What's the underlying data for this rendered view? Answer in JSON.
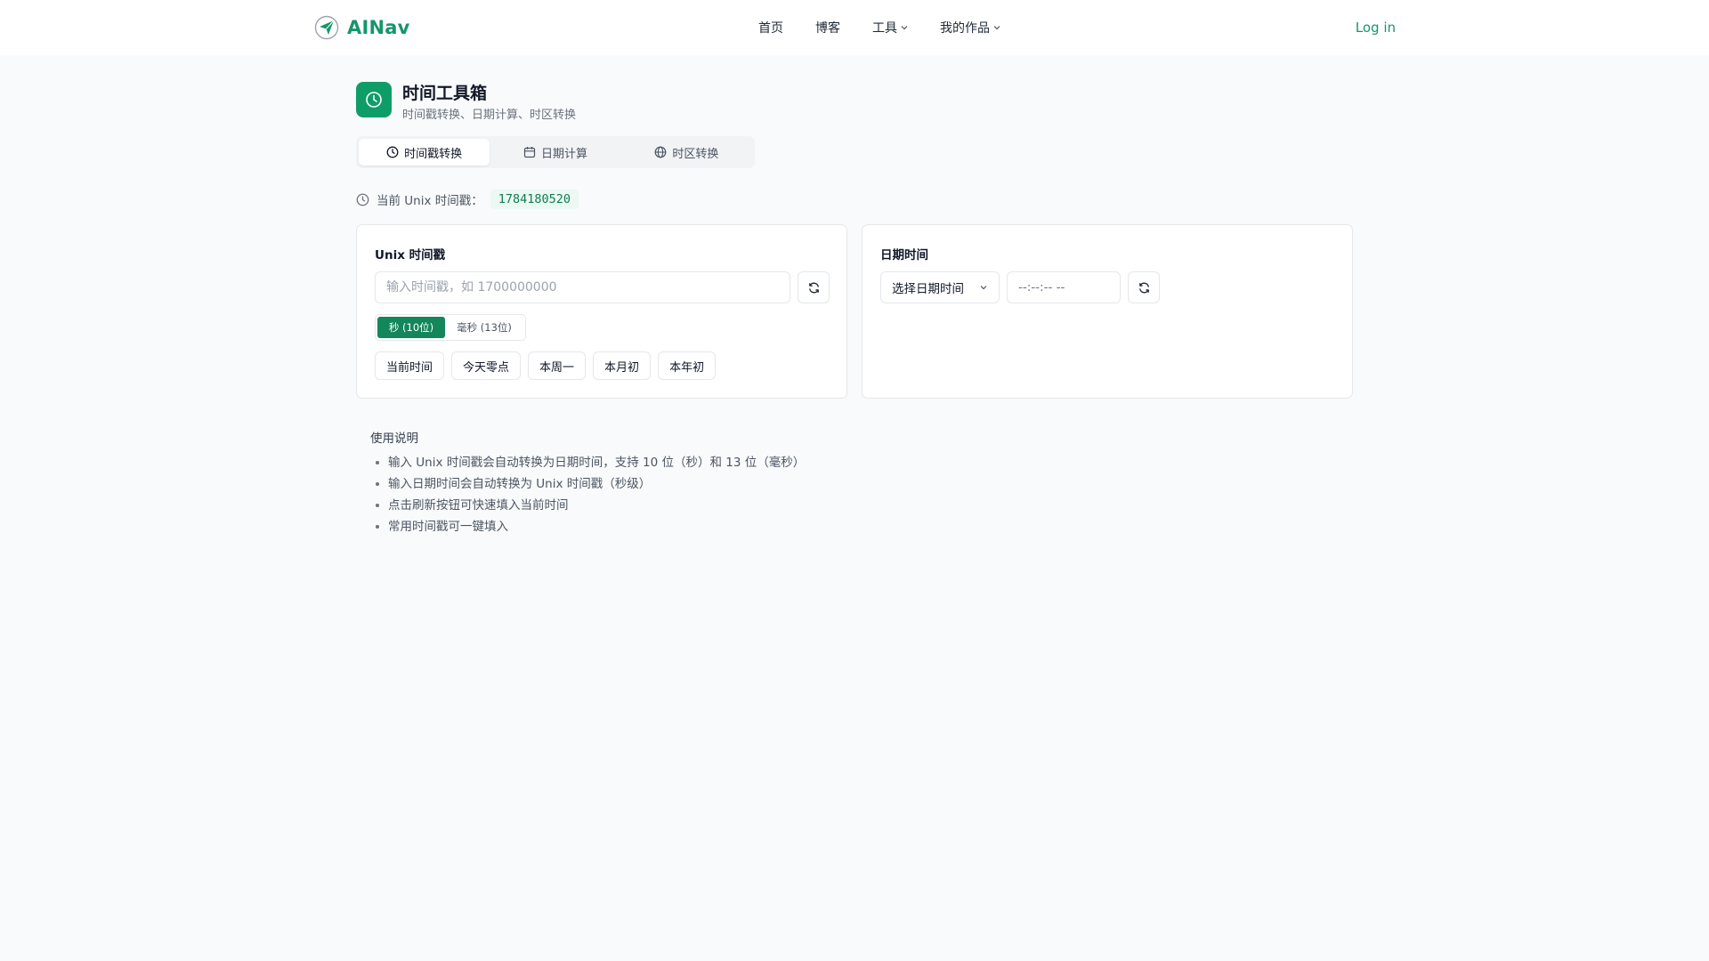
{
  "header": {
    "brand": "AINav",
    "nav": [
      "首页",
      "博客",
      "工具",
      "我的作品"
    ],
    "login": "Log in"
  },
  "page": {
    "title": "时间工具箱",
    "subtitle": "时间戳转换、日期计算、时区转换"
  },
  "tabs": [
    "时间戳转换",
    "日期计算",
    "时区转换"
  ],
  "current": {
    "label": "当前 Unix 时间戳：",
    "value": "1784180520"
  },
  "unix_card": {
    "title": "Unix 时间戳",
    "placeholder": "输入时间戳，如 1700000000",
    "units": [
      "秒 (10位)",
      "毫秒 (13位)"
    ],
    "quick": [
      "当前时间",
      "今天零点",
      "本周一",
      "本月初",
      "本年初"
    ]
  },
  "date_card": {
    "title": "日期时间",
    "date_select": "选择日期时间",
    "time_placeholder": "--:--:-- --"
  },
  "usage": {
    "title": "使用说明",
    "items": [
      "输入 Unix 时间戳会自动转换为日期时间，支持 10 位（秒）和 13 位（毫秒）",
      "输入日期时间会自动转换为 Unix 时间戳（秒级）",
      "点击刷新按钮可快速填入当前时间",
      "常用时间戳可一键填入"
    ]
  },
  "colors": {
    "brand": "#16966a",
    "accent": "#0f9d67",
    "badge_bg": "#ecf8f2",
    "unit_active": "#13865a"
  },
  "icons": {
    "logo": "paper-plane-icon",
    "title": "clock-icon",
    "tab_timestamp": "clock-icon",
    "tab_date": "calendar-icon",
    "tab_timezone": "globe-icon",
    "refresh": "refresh-icon",
    "chevron": "chevron-down-icon"
  }
}
